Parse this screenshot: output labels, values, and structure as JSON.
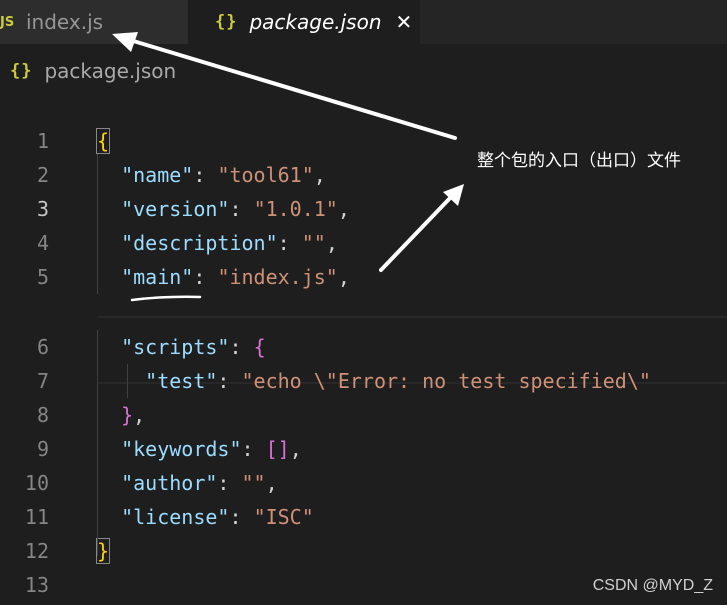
{
  "tabs": [
    {
      "icon": "JS",
      "label": "index.js",
      "active": false
    },
    {
      "icon": "{}",
      "label": "package.json",
      "active": true,
      "close": "✕"
    }
  ],
  "breadcrumb": {
    "icon": "{}",
    "label": "package.json"
  },
  "annotation": {
    "text": "整个包的入口（出口）文件"
  },
  "watermark": "CSDN @MYD_Z",
  "editor": {
    "active_line": 3,
    "lines": [
      {
        "n": "1",
        "parts": [
          [
            "{",
            "b1 bracket-box"
          ]
        ]
      },
      {
        "n": "2",
        "parts": [
          [
            "  ",
            "p"
          ],
          [
            "\"name\"",
            "k"
          ],
          [
            ": ",
            "p"
          ],
          [
            "\"tool61\"",
            "s"
          ],
          [
            ",",
            "p"
          ]
        ]
      },
      {
        "n": "3",
        "parts": [
          [
            "  ",
            "p"
          ],
          [
            "\"version\"",
            "k"
          ],
          [
            ": ",
            "p"
          ],
          [
            "\"1.0.1\"",
            "s"
          ],
          [
            ",",
            "p"
          ]
        ]
      },
      {
        "n": "4",
        "parts": [
          [
            "  ",
            "p"
          ],
          [
            "\"description\"",
            "k"
          ],
          [
            ": ",
            "p"
          ],
          [
            "\"\"",
            "s"
          ],
          [
            ",",
            "p"
          ]
        ]
      },
      {
        "n": "5",
        "parts": [
          [
            "  ",
            "p"
          ],
          [
            "\"main\"",
            "k"
          ],
          [
            ": ",
            "p"
          ],
          [
            "\"index.js\"",
            "s"
          ],
          [
            ",",
            "p"
          ]
        ]
      },
      {
        "n": "6",
        "parts": [
          [
            "  ",
            "p"
          ],
          [
            "\"scripts\"",
            "k"
          ],
          [
            ": ",
            "p"
          ],
          [
            "{",
            "b2"
          ]
        ]
      },
      {
        "n": "7",
        "parts": [
          [
            "    ",
            "p"
          ],
          [
            "\"test\"",
            "k"
          ],
          [
            ": ",
            "p"
          ],
          [
            "\"echo \\\"Error: no test specified\\\"",
            "s"
          ]
        ]
      },
      {
        "n": "8",
        "parts": [
          [
            "  ",
            "p"
          ],
          [
            "}",
            "b2"
          ],
          [
            ",",
            "p"
          ]
        ]
      },
      {
        "n": "9",
        "parts": [
          [
            "  ",
            "p"
          ],
          [
            "\"keywords\"",
            "k"
          ],
          [
            ": ",
            "p"
          ],
          [
            "[]",
            "b2"
          ],
          [
            ",",
            "p"
          ]
        ]
      },
      {
        "n": "10",
        "parts": [
          [
            "  ",
            "p"
          ],
          [
            "\"author\"",
            "k"
          ],
          [
            ": ",
            "p"
          ],
          [
            "\"\"",
            "s"
          ],
          [
            ",",
            "p"
          ]
        ]
      },
      {
        "n": "11",
        "parts": [
          [
            "  ",
            "p"
          ],
          [
            "\"license\"",
            "k"
          ],
          [
            ": ",
            "p"
          ],
          [
            "\"ISC\"",
            "s"
          ]
        ]
      },
      {
        "n": "12",
        "parts": [
          [
            "}",
            "b1 bracket-box"
          ]
        ]
      },
      {
        "n": "13",
        "parts": []
      }
    ]
  },
  "colors": {
    "background": "#1e1e1e",
    "tab_inactive": "#2d2d2d",
    "keyword": "#9cdcfe",
    "string": "#ce9178",
    "bracket_outer": "#ffd700",
    "bracket_inner": "#da70d6",
    "icon_yellow": "#cbcb41"
  }
}
